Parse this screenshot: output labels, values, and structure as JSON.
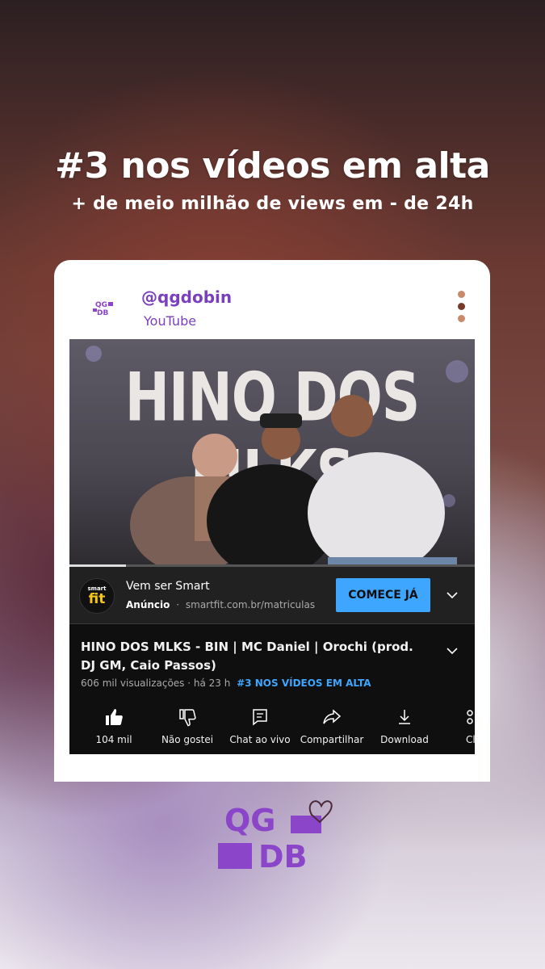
{
  "headline": "#3 nos vídeos em alta",
  "subline": "+ de meio milhão de views em - de 24h",
  "post": {
    "handle": "@qgdobin",
    "platform": "YouTube",
    "avatar_text": "QG DB"
  },
  "video": {
    "thumbnail_text": "HINO DOS MLKS",
    "progress": 0.14,
    "title": "HINO DOS MLKS - BIN | MC Daniel | Orochi (prod. DJ GM, Caio Passos)",
    "views": "606 mil visualizações · há 23 h",
    "trending": "#3 NOS VÍDEOS EM ALTA"
  },
  "ad": {
    "logo_top": "smart",
    "logo_main": "fit",
    "title": "Vem ser Smart",
    "label": "Anúncio",
    "separator": "·",
    "url": "smartfit.com.br/matriculas",
    "cta": "COMECE JÁ"
  },
  "actions": [
    {
      "label": "104 mil",
      "icon": "thumbs-up-icon"
    },
    {
      "label": "Não gostei",
      "icon": "thumbs-down-icon"
    },
    {
      "label": "Chat ao vivo",
      "icon": "chat-icon"
    },
    {
      "label": "Compartilhar",
      "icon": "share-icon"
    },
    {
      "label": "Download",
      "icon": "download-icon"
    },
    {
      "label": "Cl",
      "icon": "clip-icon"
    }
  ],
  "brand": {
    "line1": "QG",
    "line2": "DB"
  },
  "colors": {
    "accent_purple": "#7a3fbf",
    "brand_purple": "#8a45c8",
    "youtube_dark": "#0f0f0f",
    "cta_blue": "#3ea6ff",
    "menu_dot_light": "#c98a6a",
    "menu_dot_dark": "#7a3a2a"
  }
}
